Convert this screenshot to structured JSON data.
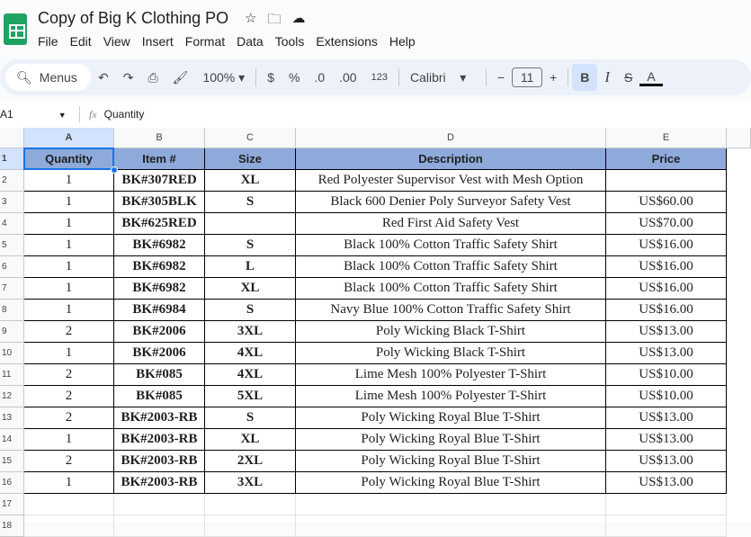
{
  "doc_title": "Copy of Big K Clothing PO",
  "menu": [
    "File",
    "Edit",
    "View",
    "Insert",
    "Format",
    "Data",
    "Tools",
    "Extensions",
    "Help"
  ],
  "toolbar": {
    "search": "Menus",
    "zoom": "100%",
    "currency": "$",
    "percent": "%",
    "dec_less": ".0",
    "dec_more": ".00",
    "format_123": "123",
    "font": "Calibri",
    "font_size": "11"
  },
  "formula_bar": {
    "cell_ref": "A1",
    "value": "Quantity"
  },
  "columns": [
    "A",
    "B",
    "C",
    "D",
    "E"
  ],
  "headers": [
    "Quantity",
    "Item #",
    "Size",
    "Description",
    "Price"
  ],
  "rows": [
    [
      "1",
      "BK#307RED",
      "XL",
      "Red Polyester Supervisor Vest with Mesh Option",
      ""
    ],
    [
      "1",
      "BK#305BLK",
      "S",
      "Black 600 Denier Poly Surveyor Safety Vest",
      "US$60.00"
    ],
    [
      "1",
      "BK#625RED",
      "",
      "Red First Aid Safety Vest",
      "US$70.00"
    ],
    [
      "1",
      "BK#6982",
      "S",
      "Black 100% Cotton Traffic Safety Shirt",
      "US$16.00"
    ],
    [
      "1",
      "BK#6982",
      "L",
      "Black 100% Cotton Traffic Safety Shirt",
      "US$16.00"
    ],
    [
      "1",
      "BK#6982",
      "XL",
      "Black 100% Cotton Traffic Safety Shirt",
      "US$16.00"
    ],
    [
      "1",
      "BK#6984",
      "S",
      "Navy Blue 100% Cotton Traffic Safety Shirt",
      "US$16.00"
    ],
    [
      "2",
      "BK#2006",
      "3XL",
      "Poly Wicking Black T-Shirt",
      "US$13.00"
    ],
    [
      "1",
      "BK#2006",
      "4XL",
      "Poly Wicking Black T-Shirt",
      "US$13.00"
    ],
    [
      "2",
      "BK#085",
      "4XL",
      "Lime Mesh 100% Polyester T-Shirt",
      "US$10.00"
    ],
    [
      "2",
      "BK#085",
      "5XL",
      "Lime Mesh 100% Polyester T-Shirt",
      "US$10.00"
    ],
    [
      "2",
      "BK#2003-RB",
      "S",
      "Poly Wicking Royal Blue T-Shirt",
      "US$13.00"
    ],
    [
      "1",
      "BK#2003-RB",
      "XL",
      "Poly Wicking Royal Blue T-Shirt",
      "US$13.00"
    ],
    [
      "2",
      "BK#2003-RB",
      "2XL",
      "Poly Wicking Royal Blue T-Shirt",
      "US$13.00"
    ],
    [
      "1",
      "BK#2003-RB",
      "3XL",
      "Poly Wicking Royal Blue T-Shirt",
      "US$13.00"
    ]
  ],
  "row_numbers": [
    "1",
    "2",
    "3",
    "4",
    "5",
    "6",
    "7",
    "8",
    "9",
    "10",
    "11",
    "12",
    "13",
    "14",
    "15",
    "16",
    "17",
    "18"
  ]
}
